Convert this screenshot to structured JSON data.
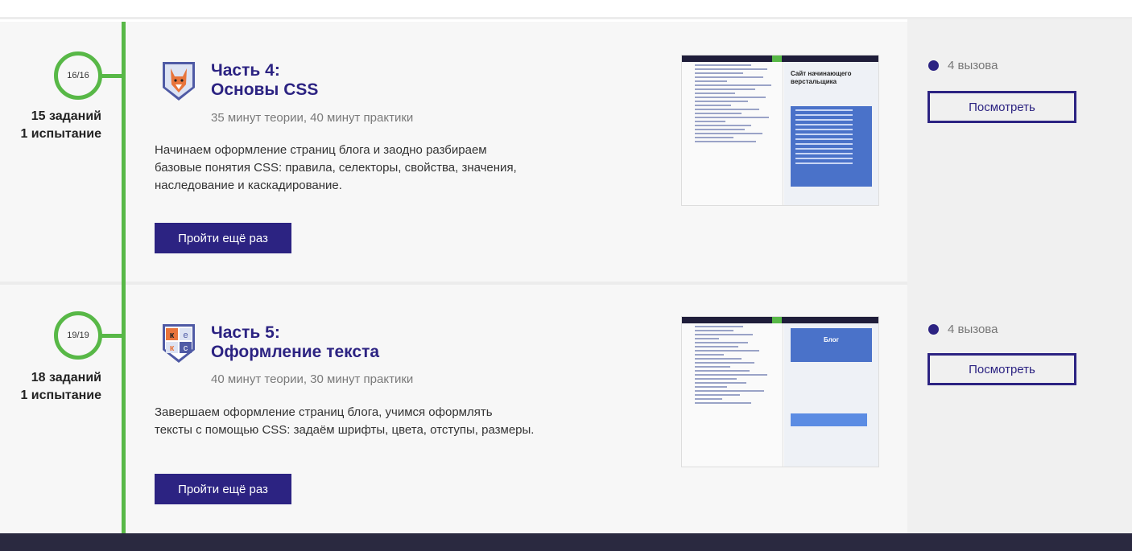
{
  "course": {
    "parts": [
      {
        "progress": "16/16",
        "tasks": "15 заданий",
        "challenge": "1 испытание",
        "title_line1": "Часть 4:",
        "title_line2": "Основы CSS",
        "duration": "35 минут теории, 40 минут практики",
        "desc_lines": [
          "Начинаем оформление страниц блога и заодно разбираем",
          "базовые понятия CSS: правила, селекторы, свойства, значения,",
          "наследование и каскадирование."
        ],
        "repeat_label": "Пройти ещё раз",
        "preview_heading": "Сайт начинающего верстальщика",
        "calls": "4 вызова",
        "view_label": "Посмотреть"
      },
      {
        "progress": "19/19",
        "tasks": "18 заданий",
        "challenge": "1 испытание",
        "title_line1": "Часть 5:",
        "title_line2": "Оформление текста",
        "duration": "40 минут теории, 30 минут практики",
        "desc_lines": [
          "Завершаем оформление страниц блога, учимся оформлять",
          "тексты с помощью CSS: задаём шрифты, цвета, отступы, размеры."
        ],
        "repeat_label": "Пройти ещё раз",
        "preview_heading": "Блог",
        "calls": "4 вызова",
        "view_label": "Посмотреть"
      }
    ]
  },
  "colors": {
    "accent": "#2c2382",
    "progress_green": "#58b847",
    "footer": "#2a2940"
  },
  "icons": [
    "fox-shield-icon",
    "kekc-shield-icon",
    "bullet-dot-icon"
  ]
}
